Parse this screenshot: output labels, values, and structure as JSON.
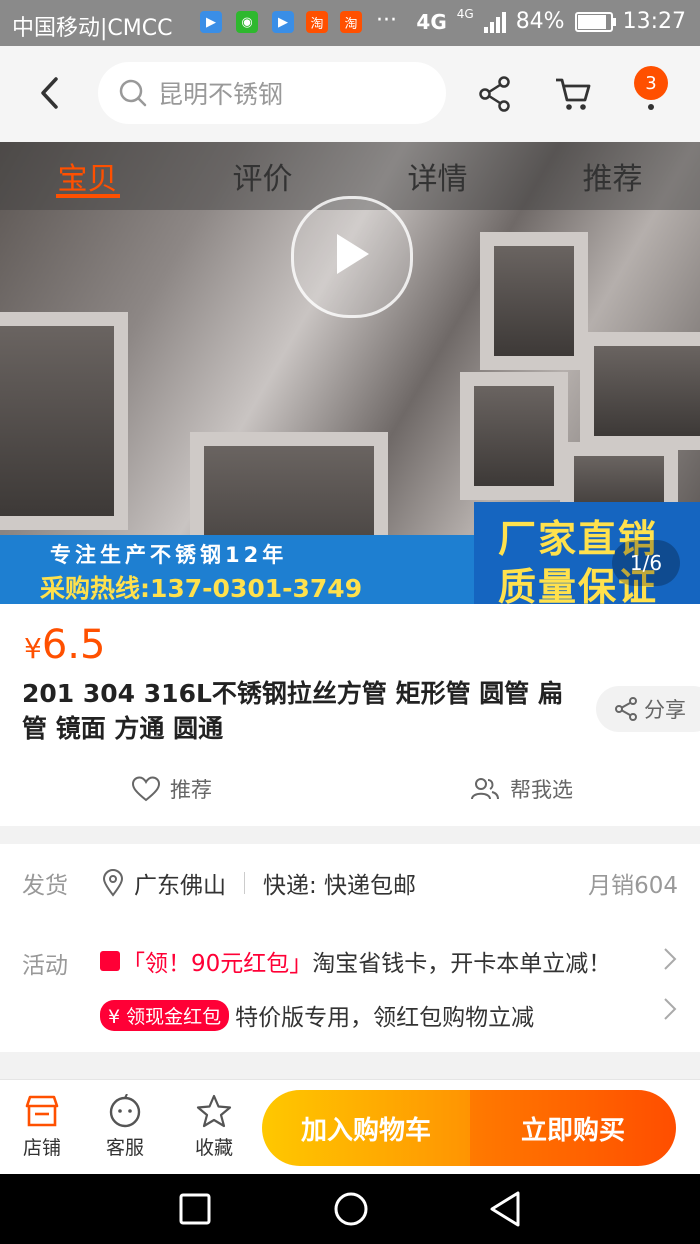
{
  "status_bar": {
    "carrier": "中国移动|CMCC",
    "net1": "4G",
    "net2": "4G",
    "battery": "84%",
    "battery_level": 0.84,
    "time": "13:27",
    "more": "···"
  },
  "top_nav": {
    "search_placeholder": "昆明不锈钢",
    "cart_count": "3"
  },
  "tabs": [
    "宝贝",
    "评价",
    "详情",
    "推荐"
  ],
  "gallery": {
    "banner_line1": "专注生产不锈钢12年",
    "banner_line2": "采购热线:137-0301-3749",
    "banner_right1": "厂家直销",
    "banner_right2": "质量保证",
    "pager": "1/6"
  },
  "product": {
    "currency": "¥",
    "price": "6.5",
    "title": "201 304 316L不锈钢拉丝方管 矩形管 圆管 扁管 镜面 方通 圆通",
    "share_label": "分享",
    "recommend_label": "推荐",
    "help_choose_label": "帮我选"
  },
  "shipping": {
    "label": "发货",
    "location": "广东佛山",
    "delivery": "快递: 快递包邮",
    "monthly_sales": "月销604"
  },
  "activity": {
    "label": "活动",
    "promo1_tag": "「领！90元红包」",
    "promo1_text": "淘宝省钱卡，开卡本单立减！",
    "promo2_tag": "领现金红包",
    "promo2_text": "特价版专用，领红包购物立减"
  },
  "bottom_bar": {
    "store": "店铺",
    "service": "客服",
    "favorite": "收藏",
    "add_to_cart": "加入购物车",
    "buy_now": "立即购买"
  },
  "colors": {
    "accent": "#ff5000",
    "cart_btn": "#ffb000",
    "buy_btn": "#ff5a00"
  }
}
